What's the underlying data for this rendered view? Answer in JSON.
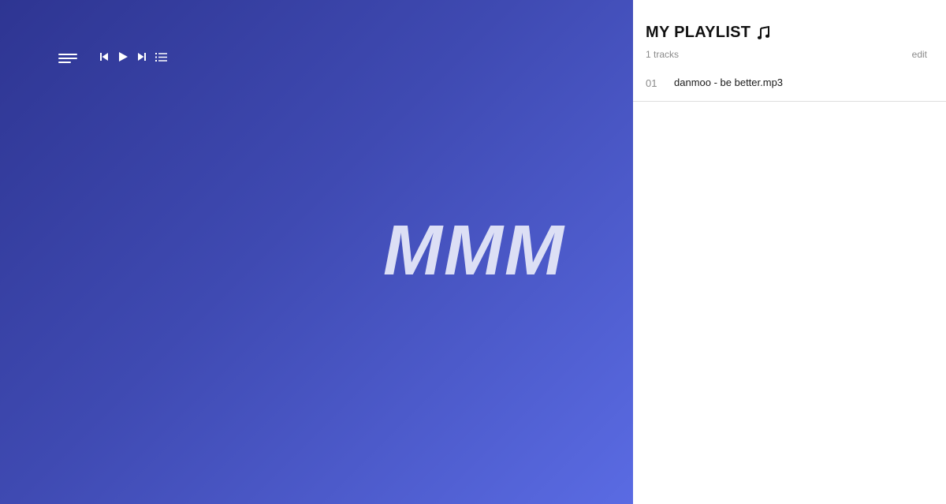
{
  "player": {
    "logo_text": "MMM",
    "controls": [
      {
        "icon": "skip-previous-icon"
      },
      {
        "icon": "play-icon"
      },
      {
        "icon": "skip-next-icon"
      },
      {
        "icon": "playlist-icon"
      }
    ],
    "menu_icon": "hamburger-menu-icon",
    "background_colors": [
      "#2e3592",
      "#3f4ab2",
      "#5a6be3"
    ],
    "logo_color": "#dcdff5"
  },
  "playlist": {
    "title": "MY PLAYLIST",
    "title_icon": "music-note-icon",
    "track_count": "1 tracks",
    "edit_label": "edit",
    "tracks": [
      {
        "number": "01",
        "name": "danmoo - be better.mp3"
      }
    ]
  }
}
